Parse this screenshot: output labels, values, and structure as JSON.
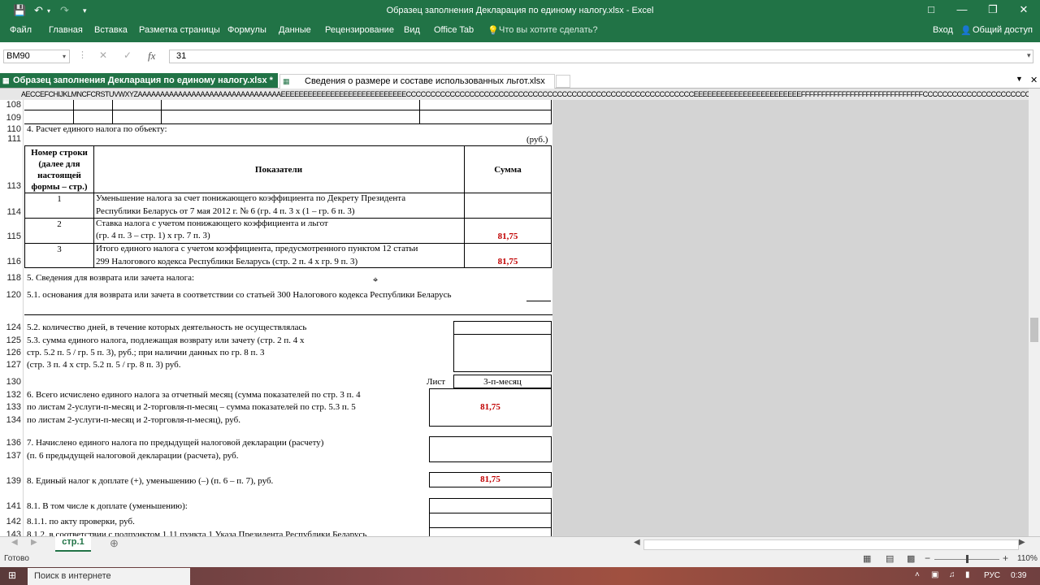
{
  "window": {
    "title": "Образец заполнения Декларация по единому налогу.xlsx - Excel"
  },
  "ribbon": {
    "tabs": [
      "Файл",
      "Главная",
      "Вставка",
      "Разметка страницы",
      "Формулы",
      "Данные",
      "Рецензирование",
      "Вид",
      "Office Tab"
    ],
    "tell_me": "Что вы хотите сделать?",
    "signin": "Вход",
    "share": "Общий доступ"
  },
  "formula_bar": {
    "name_box": "BM90",
    "fx": "fx",
    "value": "31"
  },
  "office_tabs": {
    "active": "Образец заполнения Декларация по единому налогу.xlsx *",
    "other": "Сведения о размере и составе использованных льгот.xlsx"
  },
  "column_header": "AECCEFCHIJKLMNCFCRSTUVWXYZAAAAAAAAAAAAAAAAAAAAAAAAAAAAAAAAEEEEEEEEEEEEEEEEEEEEEEEEEEEECCCCCCCCCCCCCCCCCCCCCCCCCCCCCCCCCCCCCCCCCCCCCCCCCCCCCCCCCCCEEEEEEEEEEEEEEEEEEEEEEEEFFFFFFFFFFFFFFFFFFFFFFFFFFFFFFCCCCCCCCCCCCCCCCCCCCCCCCCCCCCCCCCCCCCCCCCCC",
  "row_numbers": [
    "108",
    "109",
    "110",
    "111",
    "113",
    "114",
    "115",
    "116",
    "118",
    "120",
    "124",
    "125",
    "126",
    "127",
    "130",
    "132",
    "133",
    "134",
    "136",
    "137",
    "139",
    "141",
    "142",
    "143"
  ],
  "sheet": {
    "section4_title": "4. Расчет единого налога по объекту:",
    "unit": "(руб.)",
    "table_headers": {
      "col1": "Номер строки (далее для настоящей формы – стр.)",
      "col2": "Показатели",
      "col3": "Сумма"
    },
    "table_rows": [
      {
        "num": "1",
        "line1": "Уменьшение налога за счет понижающего коэффициента по Декрету Президента",
        "line2": "Республики Беларусь от 7 мая 2012 г. № 6 (гр. 4 п. 3 х (1 – гр. 6 п. 3)",
        "sum": ""
      },
      {
        "num": "2",
        "line1": "Ставка налога с учетом понижающего коэффициента и льгот",
        "line2": "(гр. 4 п. 3 – стр. 1) х гр. 7 п. 3)",
        "sum": "81,75"
      },
      {
        "num": "3",
        "line1": "Итого единого налога с учетом коэффициента, предусмотренного пунктом 12 статьи",
        "line2": "299 Налогового кодекса Республики Беларусь (стр. 2 п. 4 х гр. 9 п. 3)",
        "sum": "81,75"
      }
    ],
    "section5_title": "5. Сведения для возврата или зачета налога:",
    "s5_1": "5.1. основания для возврата или зачета в соответствии со статьей 300 Налогового кодекса Республики Беларусь",
    "s5_2": "5.2. количество дней, в течение которых деятельность не осуществлялась",
    "s5_3_l1": "5.3. сумма единого налога, подлежащая возврату или зачету (стр. 2 п. 4 х",
    "s5_3_l2": "стр. 5.2 п. 5 / гр. 5 п. 3), руб.; при наличии данных по гр. 8 п. 3",
    "s5_3_l3": "(стр. 3 п. 4 х стр. 5.2 п. 5 / гр. 8 п. 3) руб.",
    "list_label": "Лист",
    "list_value": "3-п-месяц",
    "s6_l1": "6. Всего исчислено единого налога за отчетный месяц (сумма показателей по стр. 3 п. 4",
    "s6_l2": "по листам 2-услуги-п-месяц и 2-торговля-п-месяц – сумма показателей по стр. 5.3 п. 5",
    "s6_l3": "по листам 2-услуги-п-месяц и 2-торговля-п-месяц), руб.",
    "s6_value": "81,75",
    "s7_l1": "7. Начислено единого налога по предыдущей налоговой декларации (расчету)",
    "s7_l2": "(п. 6 предыдущей налоговой декларации (расчета), руб.",
    "s8": "8. Единый налог к доплате (+), уменьшению (–) (п. 6 – п. 7), руб.",
    "s8_value": "81,75",
    "s8_1": "8.1. В том числе к доплате (уменьшению):",
    "s8_1_1": "8.1.1. по акту проверки, руб.",
    "s8_1_2": "8.1.2. в соответствии с подпунктом 1.11 пункта 1 Указа Президента Республики Беларусь"
  },
  "sheet_tab": "стр.1",
  "status": {
    "ready": "Готово",
    "zoom": "110%"
  },
  "taskbar": {
    "search": "Поиск в интернете",
    "lang": "РУС",
    "time": "0:39"
  }
}
